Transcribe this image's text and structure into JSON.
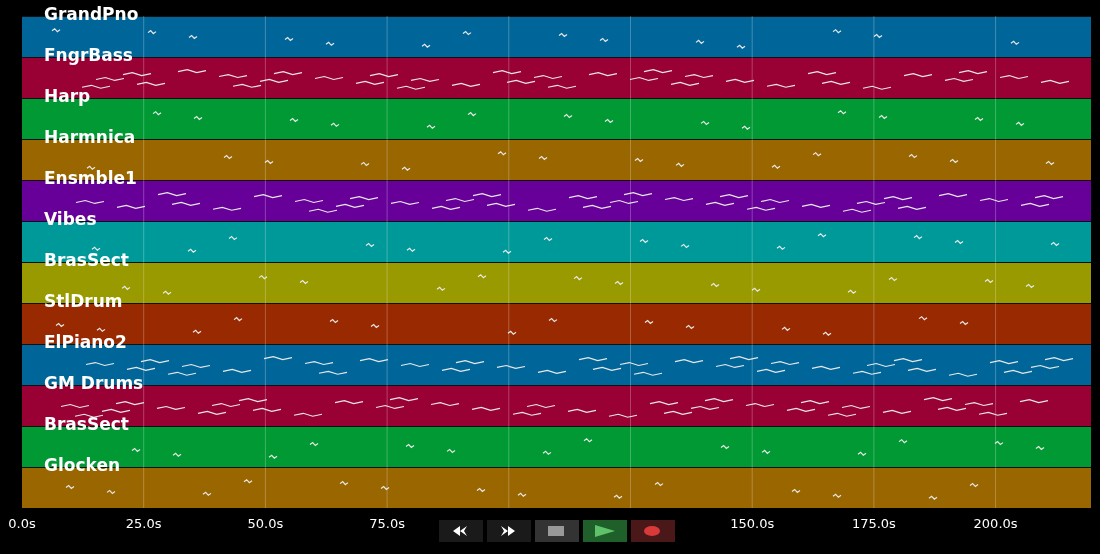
{
  "tracks": [
    {
      "name": "GrandPno",
      "color": "#006699"
    },
    {
      "name": "FngrBass",
      "color": "#990033"
    },
    {
      "name": "Harp",
      "color": "#009933"
    },
    {
      "name": "Harmnica",
      "color": "#996600"
    },
    {
      "name": "Ensmble1",
      "color": "#660099"
    },
    {
      "name": "Vibes",
      "color": "#009999"
    },
    {
      "name": "BrasSect",
      "color": "#999900"
    },
    {
      "name": "StlDrum",
      "color": "#992900"
    },
    {
      "name": "ElPiano2",
      "color": "#006699"
    },
    {
      "name": "GM Drums",
      "color": "#990033"
    },
    {
      "name": "BrasSect",
      "color": "#009933"
    },
    {
      "name": "Glocken",
      "color": "#996600"
    }
  ],
  "axis_labels": [
    "0.0s",
    "25.0s",
    "50.0s",
    "75.0s",
    "150.0s",
    "175.0s",
    "200.0s"
  ],
  "controls": [
    {
      "kind": "rewind"
    },
    {
      "kind": "forward"
    },
    {
      "kind": "stop"
    },
    {
      "kind": "play"
    },
    {
      "kind": "record"
    }
  ]
}
